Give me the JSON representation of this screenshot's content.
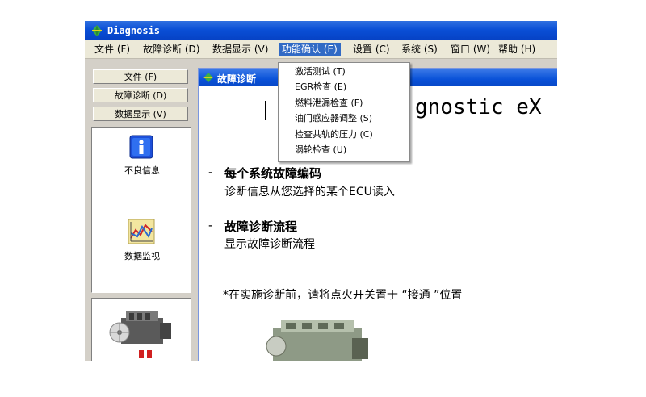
{
  "window": {
    "title": "Diagnosis"
  },
  "menubar": {
    "items": [
      {
        "label": "文件 (F)"
      },
      {
        "label": "故障诊断 (D)"
      },
      {
        "label": "数据显示 (V)"
      },
      {
        "label": "功能确认 (E)"
      },
      {
        "label": "设置 (C)"
      },
      {
        "label": "系统 (S)"
      },
      {
        "label": "窗口 (W)"
      },
      {
        "label": "帮助 (H)"
      }
    ],
    "active_index": 3
  },
  "dropdown": {
    "items": [
      {
        "label": "激活测试 (T)"
      },
      {
        "label": "EGR检查 (E)"
      },
      {
        "label": "燃料泄漏检查 (F)"
      },
      {
        "label": "油门感应器调整 (S)"
      },
      {
        "label": "检查共轨的压力 (C)"
      },
      {
        "label": "涡轮检查 (U)"
      }
    ]
  },
  "sidebar": {
    "buttons": [
      {
        "label": "文件 (F)"
      },
      {
        "label": "故障诊断 (D)"
      },
      {
        "label": "数据显示 (V)"
      }
    ],
    "icons": [
      {
        "label": "不良信息",
        "icon": "info-icon"
      },
      {
        "label": "数据监视",
        "icon": "chart-icon"
      }
    ]
  },
  "child_window": {
    "title": "故障诊断",
    "banner": "gnostic eX",
    "sections": [
      {
        "dash": "-",
        "title": "每个系统故障编码",
        "desc": "诊断信息从您选择的某个ECU读入"
      },
      {
        "dash": "-",
        "title": "故障诊断流程",
        "desc": "显示故障诊断流程"
      }
    ],
    "note": "*在实施诊断前，请将点火开关置于 “接通 ”位置"
  },
  "colors": {
    "accent": "#0a4fd6",
    "menu_highlight": "#316ac5",
    "chrome": "#d4d0c8"
  }
}
